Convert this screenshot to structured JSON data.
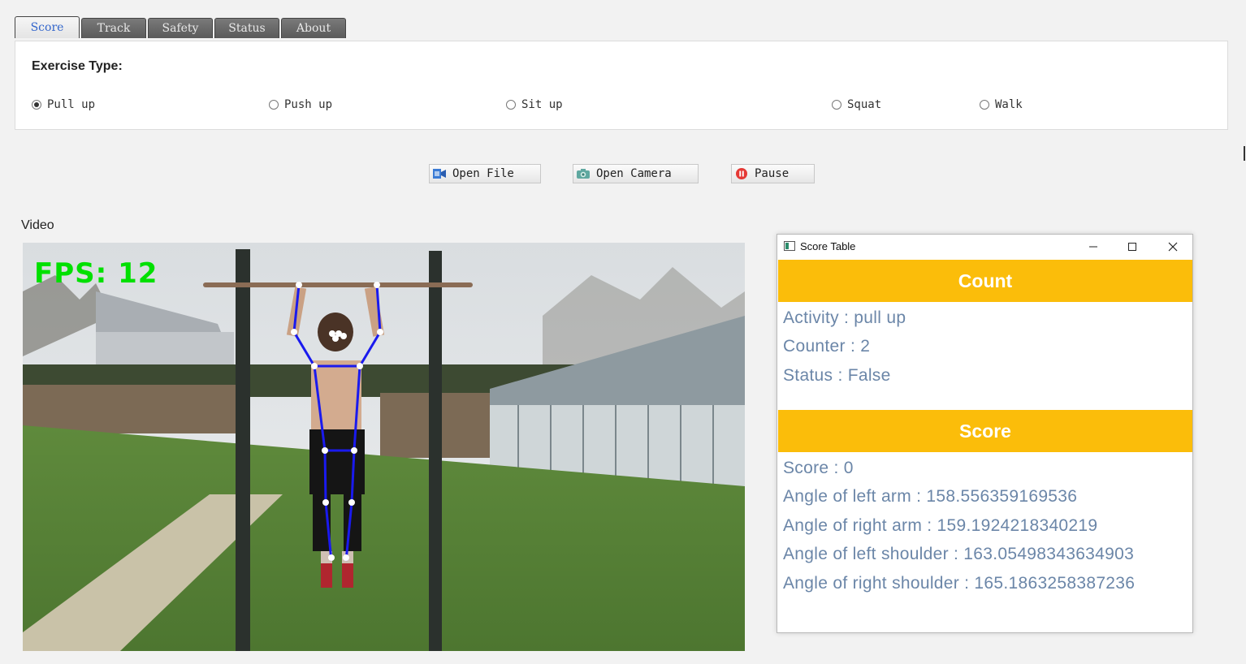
{
  "tabs": [
    {
      "label": "Score",
      "active": true
    },
    {
      "label": "Track",
      "active": false
    },
    {
      "label": "Safety",
      "active": false
    },
    {
      "label": "Status",
      "active": false
    },
    {
      "label": "About",
      "active": false
    }
  ],
  "exercise": {
    "title": "Exercise Type:",
    "options": [
      {
        "label": "Pull up",
        "checked": true
      },
      {
        "label": "Push up",
        "checked": false
      },
      {
        "label": "Sit up",
        "checked": false
      },
      {
        "label": "Squat",
        "checked": false
      },
      {
        "label": "Walk",
        "checked": false
      }
    ]
  },
  "toolbar": {
    "open_file": {
      "label": "Open File",
      "icon": "file-video-icon"
    },
    "open_camera": {
      "label": "Open Camera",
      "icon": "camera-icon"
    },
    "pause": {
      "label": "Pause",
      "icon": "pause-icon"
    }
  },
  "video": {
    "label": "Video",
    "fps_overlay": "FPS: 12"
  },
  "score_table": {
    "window_title": "Score Table",
    "count_header": "Count",
    "activity": "Activity : pull up",
    "counter": "Counter : 2",
    "status": "Status : False",
    "score_header": "Score",
    "score": "Score : 0",
    "angle_left_arm": "Angle of left arm : 158.556359169536",
    "angle_right_arm": "Angle of right arm : 159.1924218340219",
    "angle_left_shoulder": "Angle of left shoulder : 163.05498343634903",
    "angle_right_shoulder": "Angle of right shoulder : 165.1863258387236"
  },
  "colors": {
    "header_bg": "#fbbd0a",
    "stat_text": "#6b86a8",
    "fps_text": "#00e000",
    "skeleton": "#1a1aee",
    "active_tab_text": "#3366cc"
  }
}
